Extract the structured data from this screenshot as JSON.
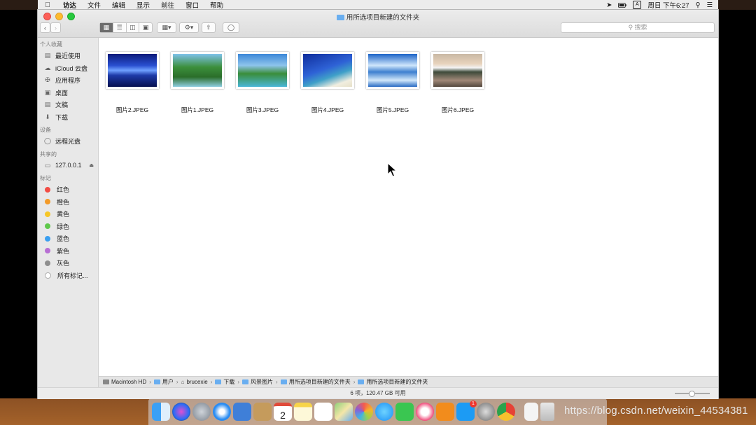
{
  "menubar": {
    "app": "访达",
    "items": [
      "文件",
      "编辑",
      "显示",
      "前往",
      "窗口",
      "帮助"
    ],
    "clock": "周日 下午6:27"
  },
  "window": {
    "title": "用所选项目新建的文件夹",
    "search_placeholder": "搜索"
  },
  "sidebar": {
    "favorites_header": "个人收藏",
    "favorites": [
      "最近使用",
      "iCloud 云盘",
      "应用程序",
      "桌面",
      "文稿",
      "下载"
    ],
    "devices_header": "设备",
    "devices": [
      "远程光盘"
    ],
    "shared_header": "共享的",
    "shared": [
      "127.0.0.1"
    ],
    "tags_header": "标记",
    "tags": [
      {
        "label": "红色",
        "color": "#f24c44"
      },
      {
        "label": "橙色",
        "color": "#f39a28"
      },
      {
        "label": "黄色",
        "color": "#f6c625"
      },
      {
        "label": "绿色",
        "color": "#5ec84a"
      },
      {
        "label": "蓝色",
        "color": "#3a9ff0"
      },
      {
        "label": "紫色",
        "color": "#b86fd4"
      },
      {
        "label": "灰色",
        "color": "#8e8e8e"
      }
    ],
    "all_tags": "所有标记..."
  },
  "files": [
    "图片2.JPEG",
    "图片1.JPEG",
    "图片3.JPEG",
    "图片4.JPEG",
    "图片5.JPEG",
    "图片6.JPEG"
  ],
  "pathbar": [
    "Macintosh HD",
    "用户",
    "brucexie",
    "下载",
    "风景图片",
    "用所选项目新建的文件夹",
    "用所选项目新建的文件夹"
  ],
  "status": "6 项，120.47 GB 可用",
  "dock": {
    "calendar_day": "2",
    "appstore_badge": "1"
  },
  "watermark": "https://blog.csdn.net/weixin_44534381"
}
